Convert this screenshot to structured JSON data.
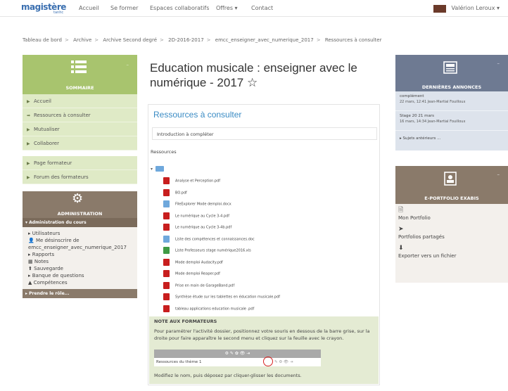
{
  "navbar": {
    "logo": "magistère",
    "logo_sub": "tanhc",
    "items": [
      "Accueil",
      "Se former",
      "Espaces collaboratifs",
      "Offres ▾",
      "Contact"
    ],
    "user": "Valérion Leroux ▾"
  },
  "breadcrumb": [
    "Tableau de bord",
    "Archive",
    "Archive Second degré",
    "2D-2016-2017",
    "emcc_enseigner_avec_numerique_2017",
    "Ressources à consulter"
  ],
  "summary": {
    "title": "SOMMAIRE",
    "items": [
      "Accueil",
      "Ressources à consulter",
      "Mutualiser",
      "Collaborer"
    ],
    "items2": [
      "Page formateur",
      "Forum des formateurs"
    ]
  },
  "admin": {
    "title": "ADMINISTRATION",
    "sub": "▾ Administration du cours",
    "lines": [
      "▸ Utilisateurs",
      "👤 Me désinscrire de",
      "emcc_enseigner_avec_numerique_2017",
      "▸ Rapports",
      "▦ Notes",
      "⬆ Sauvegarde",
      "▸ Banque de questions",
      "▲ Compétences"
    ],
    "footer": "▸ Prendre le rôle..."
  },
  "main": {
    "title": "Education musicale : enseigner avec le numérique - 2017 ☆",
    "section_title": "Ressources à consulter",
    "intro": "Introduction à compléter",
    "resources_label": "Ressources",
    "files": [
      {
        "name": "Analyse et Perception.pdf",
        "type": "pdf"
      },
      {
        "name": "BO.pdf",
        "type": "pdf"
      },
      {
        "name": "FileExplorer Mode demploi.docx",
        "type": "doc"
      },
      {
        "name": "Le numérique au Cycle 3-4.pdf",
        "type": "pdf"
      },
      {
        "name": "Le numérique au Cycle 3-4b.pdf",
        "type": "pdf"
      },
      {
        "name": "Liste des compétences et connaissances.doc",
        "type": "doc"
      },
      {
        "name": "Liste Professeurs stage numérique2016.xls",
        "type": "xls"
      },
      {
        "name": "Mode demploi Audacity.pdf",
        "type": "pdf"
      },
      {
        "name": "Mode demploi Reaper.pdf",
        "type": "pdf"
      },
      {
        "name": "Prise en main de GarageBand.pdf",
        "type": "pdf"
      },
      {
        "name": "Synthèse étude sur les tablettes en éducation musicale.pdf",
        "type": "pdf"
      },
      {
        "name": "tableau applications education musicale .pdf",
        "type": "pdf"
      }
    ],
    "notes_head": "NOTE AUX FORMATEURS",
    "notes_text": "Pour paramétrer l'activité dossier, positionnez votre souris en dessous de la barre grise, sur la droite pour faire apparaître le second menu et cliquez sur la feuille avec le crayon.",
    "notes_bar": "⚙ ✎ ✿ 👁 ⇥",
    "notes_row": "Ressources du thème 1",
    "notes_row_icons": "✎  ⚙  👁  ⇥",
    "notes_bottom": "Modifiez le nom, puis déposez par cliquer-glisser les documents."
  },
  "announcements": {
    "title": "DERNIÈRES ANNONCES",
    "items": [
      {
        "title": "complément",
        "date": "22 mars, 12:41 Jean-Martial Fouilloux"
      },
      {
        "title": "Stage 20 21 mars",
        "date": "16 mars, 14:34 Jean-Martial Fouilloux"
      }
    ],
    "more": "▸ Sujets antérieurs ..."
  },
  "eportfolio": {
    "title": "E-PORTFOLIO EXABIS",
    "links": [
      {
        "icon": "🗎",
        "label": "Mon Portfolio"
      },
      {
        "icon": "➤",
        "label": "Portfolios partagés"
      },
      {
        "icon": "⬇",
        "label": "Exporter vers un fichier"
      }
    ]
  },
  "colors": {
    "summary_green": "#a8c46e",
    "admin_brown": "#8a7a6a",
    "announce_blue": "#6e7a92",
    "link_blue": "#3a8bc4"
  }
}
